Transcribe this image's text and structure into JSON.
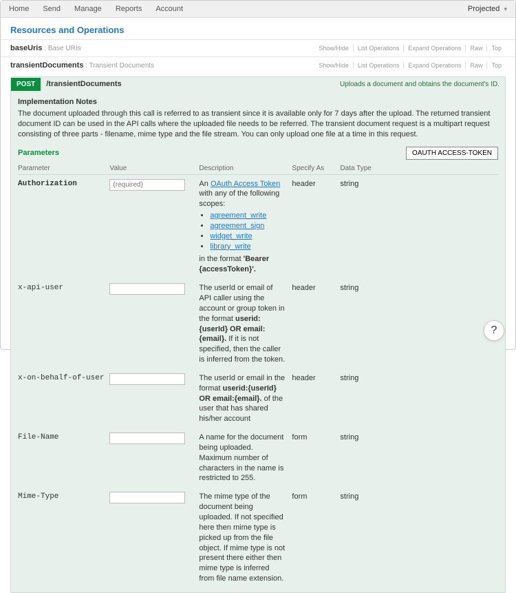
{
  "topnav": {
    "items": [
      "Home",
      "Send",
      "Manage",
      "Reports",
      "Account"
    ],
    "right_label": "Projected"
  },
  "section_title": "Resources and Operations",
  "resources": [
    {
      "name": "baseUris",
      "sub": ": Base URIs",
      "actions": [
        "Show/Hide",
        "List Operations",
        "Expand Operations",
        "Raw",
        "Top"
      ]
    },
    {
      "name": "transientDocuments",
      "sub": ": Transient Documents",
      "actions": [
        "Show/Hide",
        "List Operations",
        "Expand Operations",
        "Raw",
        "Top"
      ]
    }
  ],
  "operation": {
    "method": "POST",
    "path": "/transientDocuments",
    "summary": "Uploads a document and obtains the document's ID.",
    "impl_title": "Implementation Notes",
    "impl_text": "The document uploaded through this call is referred to as transient since it is available only for 7 days after the upload. The returned transient document ID can be used in the API calls where the uploaded file needs to be referred. The transient document request is a multipart request consisting of three parts - filename, mime type and the file stream. You can only upload one file at a time in this request.",
    "params_title": "Parameters",
    "token_button": "OAUTH ACCESS-TOKEN",
    "columns": [
      "Parameter",
      "Value",
      "Description",
      "Specify As",
      "Data Type"
    ],
    "rows": [
      {
        "name": "Authorization",
        "required": true,
        "placeholder": "(required)",
        "desc_pre": "An ",
        "desc_link": "OAuth Access Token",
        "desc_post": " with any of the following scopes:",
        "scopes": [
          "agreement_write",
          "agreement_sign",
          "widget_write",
          "library_write"
        ],
        "desc_tail_pre": "in the format ",
        "desc_tail_bold": "'Bearer {accessToken}'.",
        "specify_as": "header",
        "data_type": "string"
      },
      {
        "name": "x-api-user",
        "required": false,
        "desc_parts": {
          "a": "The userId or email of API caller using the account or group token in the format ",
          "b": "userid:{userId} OR email:{email}.",
          "c": " If it is not specified, then the caller is inferred from the token."
        },
        "specify_as": "header",
        "data_type": "string"
      },
      {
        "name": "x-on-behalf-of-user",
        "required": false,
        "desc_parts": {
          "a": "The userId or email in the format ",
          "b": "userid:{userId} OR email:{email}.",
          "c": " of the user that has shared his/her account"
        },
        "specify_as": "header",
        "data_type": "string"
      },
      {
        "name": "File-Name",
        "required": false,
        "desc_plain": "A name for the document being uploaded. Maximum number of characters in the name is restricted to 255.",
        "specify_as": "form",
        "data_type": "string"
      },
      {
        "name": "Mime-Type",
        "required": false,
        "desc_plain": "The mime type of the document being uploaded. If not specified here then mime type is picked up from the file object. If mime type is not present there either then mime type is inferred from file name extension.",
        "specify_as": "form",
        "data_type": "string"
      }
    ]
  }
}
